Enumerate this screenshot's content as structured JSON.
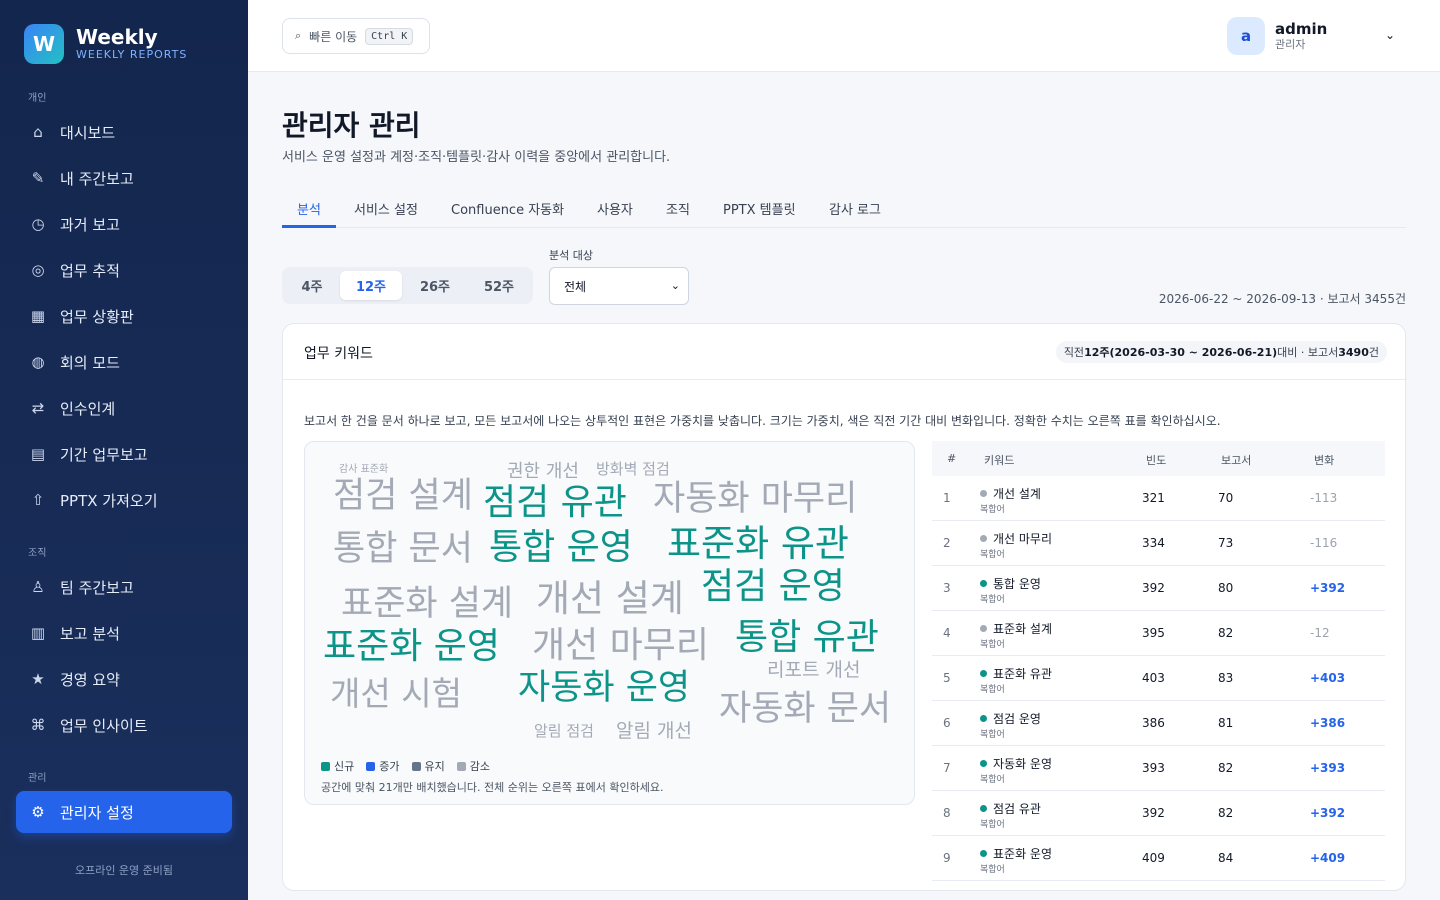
{
  "brand": {
    "logo": "W",
    "title": "Weekly",
    "subtitle": "WEEKLY REPORTS"
  },
  "sidebar": {
    "sections": [
      "개인",
      "조직",
      "관리"
    ],
    "personal": [
      {
        "icon": "⌂",
        "icon_name": "home-icon",
        "label": "대시보드"
      },
      {
        "icon": "✎",
        "icon_name": "pencil-icon",
        "label": "내 주간보고"
      },
      {
        "icon": "◷",
        "icon_name": "clock-icon",
        "label": "과거 보고"
      },
      {
        "icon": "◎",
        "icon_name": "target-icon",
        "label": "업무 추적"
      },
      {
        "icon": "▦",
        "icon_name": "grid-icon",
        "label": "업무 상황판"
      },
      {
        "icon": "◍",
        "icon_name": "meeting-icon",
        "label": "회의 모드"
      },
      {
        "icon": "⇄",
        "icon_name": "swap-icon",
        "label": "인수인계"
      },
      {
        "icon": "▤",
        "icon_name": "list-icon",
        "label": "기간 업무보고"
      },
      {
        "icon": "⇧",
        "icon_name": "upload-icon",
        "label": "PPTX 가져오기"
      }
    ],
    "org": [
      {
        "icon": "♙",
        "icon_name": "team-icon",
        "label": "팀 주간보고"
      },
      {
        "icon": "▥",
        "icon_name": "chart-icon",
        "label": "보고 분석"
      },
      {
        "icon": "★",
        "icon_name": "star-icon",
        "label": "경영 요약"
      },
      {
        "icon": "⌘",
        "icon_name": "insight-icon",
        "label": "업무 인사이트"
      }
    ],
    "admin": [
      {
        "icon": "⚙",
        "icon_name": "gear-icon",
        "label": "관리자 설정"
      }
    ],
    "footer": "오프라인 운영 준비됨"
  },
  "topbar": {
    "quick_icon": "⌕",
    "quick_label": "빠른 이동",
    "quick_shortcut": "Ctrl K",
    "user_initial": "a",
    "user_name": "admin",
    "user_role": "관리자",
    "chevron": "⌄"
  },
  "page": {
    "title": "관리자 관리",
    "description": "서비스 운영 설정과 계정·조직·템플릿·감사 이력을 중앙에서 관리합니다."
  },
  "tabs": [
    "분석",
    "서비스 설정",
    "Confluence 자동화",
    "사용자",
    "조직",
    "PPTX 템플릿",
    "감사 로그"
  ],
  "period": {
    "options": [
      "4주",
      "12주",
      "26주",
      "52주"
    ],
    "selected": "12주"
  },
  "target": {
    "label": "분석 대상",
    "value": "전체",
    "chevron": "⌄"
  },
  "range_text": "2026-06-22 ~ 2026-09-13 · 보고서 3455건",
  "keywords_card": {
    "title": "업무 키워드",
    "compare_prefix": "직전 ",
    "compare_bold1": "12주(2026-03-30 ~ 2026-06-21)",
    "compare_mid": " 대비 · 보고서 ",
    "compare_bold2": "3490",
    "compare_suffix": "건",
    "note": "보고서 한 건을 문서 하나로 보고, 모든 보고서에 나오는 상투적인 표현은 가중치를 낮춥니다. 크기는 가중치, 색은 직전 기간 대비 변화입니다. 정확한 수치는 오른쪽 표를 확인하십시오.",
    "legend": [
      {
        "label": "신규",
        "color": "#0d9488"
      },
      {
        "label": "증가",
        "color": "#2563eb"
      },
      {
        "label": "유지",
        "color": "#64748b"
      },
      {
        "label": "감소",
        "color": "#a3aab5"
      }
    ],
    "cloud_footer": "공간에 맞춰 21개만 배치했습니다. 전체 순위는 오른쪽 표에서 확인하세요.",
    "words": [
      {
        "text": "감사 표준화",
        "status": "감소"
      },
      {
        "text": "권한 개선",
        "status": "감소"
      },
      {
        "text": "방화벽 점검",
        "status": "감소"
      },
      {
        "text": "점검 설계",
        "status": "감소"
      },
      {
        "text": "점검 유관",
        "status": "신규"
      },
      {
        "text": "자동화 마무리",
        "status": "감소"
      },
      {
        "text": "통합 문서",
        "status": "감소"
      },
      {
        "text": "통합 운영",
        "status": "신규"
      },
      {
        "text": "표준화 유관",
        "status": "신규"
      },
      {
        "text": "표준화 설계",
        "status": "감소"
      },
      {
        "text": "개선 설계",
        "status": "감소"
      },
      {
        "text": "점검 운영",
        "status": "신규"
      },
      {
        "text": "표준화 운영",
        "status": "신규"
      },
      {
        "text": "개선 마무리",
        "status": "감소"
      },
      {
        "text": "통합 유관",
        "status": "신규"
      },
      {
        "text": "리포트 개선",
        "status": "감소"
      },
      {
        "text": "개선 시험",
        "status": "감소"
      },
      {
        "text": "자동화 운영",
        "status": "신규"
      },
      {
        "text": "자동화 문서",
        "status": "감소"
      },
      {
        "text": "알림 점검",
        "status": "감소"
      },
      {
        "text": "알림 개선",
        "status": "감소"
      }
    ]
  },
  "table": {
    "headers": [
      "#",
      "키워드",
      "빈도",
      "보고서",
      "변화"
    ],
    "rows": [
      {
        "rank": "1",
        "keyword": "개선 설계",
        "type": "복합어",
        "freq": "321",
        "reports": "70",
        "change": "-113",
        "trend": "down"
      },
      {
        "rank": "2",
        "keyword": "개선 마무리",
        "type": "복합어",
        "freq": "334",
        "reports": "73",
        "change": "-116",
        "trend": "down"
      },
      {
        "rank": "3",
        "keyword": "통합 운영",
        "type": "복합어",
        "freq": "392",
        "reports": "80",
        "change": "+392",
        "trend": "new"
      },
      {
        "rank": "4",
        "keyword": "표준화 설계",
        "type": "복합어",
        "freq": "395",
        "reports": "82",
        "change": "-12",
        "trend": "down"
      },
      {
        "rank": "5",
        "keyword": "표준화 유관",
        "type": "복합어",
        "freq": "403",
        "reports": "83",
        "change": "+403",
        "trend": "new"
      },
      {
        "rank": "6",
        "keyword": "점검 운영",
        "type": "복합어",
        "freq": "386",
        "reports": "81",
        "change": "+386",
        "trend": "new"
      },
      {
        "rank": "7",
        "keyword": "자동화 운영",
        "type": "복합어",
        "freq": "393",
        "reports": "82",
        "change": "+393",
        "trend": "new"
      },
      {
        "rank": "8",
        "keyword": "점검 유관",
        "type": "복합어",
        "freq": "392",
        "reports": "82",
        "change": "+392",
        "trend": "new"
      },
      {
        "rank": "9",
        "keyword": "표준화 운영",
        "type": "복합어",
        "freq": "409",
        "reports": "84",
        "change": "+409",
        "trend": "new"
      }
    ]
  }
}
